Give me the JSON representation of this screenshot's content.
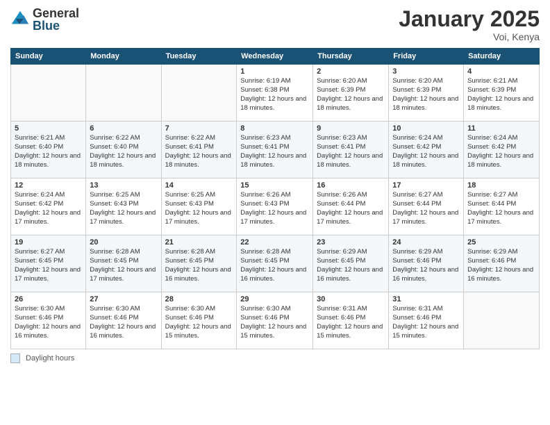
{
  "logo": {
    "general": "General",
    "blue": "Blue"
  },
  "title": "January 2025",
  "subtitle": "Voi, Kenya",
  "days_of_week": [
    "Sunday",
    "Monday",
    "Tuesday",
    "Wednesday",
    "Thursday",
    "Friday",
    "Saturday"
  ],
  "footer_label": "Daylight hours",
  "weeks": [
    [
      {
        "num": "",
        "info": ""
      },
      {
        "num": "",
        "info": ""
      },
      {
        "num": "",
        "info": ""
      },
      {
        "num": "1",
        "info": "Sunrise: 6:19 AM\nSunset: 6:38 PM\nDaylight: 12 hours and 18 minutes."
      },
      {
        "num": "2",
        "info": "Sunrise: 6:20 AM\nSunset: 6:39 PM\nDaylight: 12 hours and 18 minutes."
      },
      {
        "num": "3",
        "info": "Sunrise: 6:20 AM\nSunset: 6:39 PM\nDaylight: 12 hours and 18 minutes."
      },
      {
        "num": "4",
        "info": "Sunrise: 6:21 AM\nSunset: 6:39 PM\nDaylight: 12 hours and 18 minutes."
      }
    ],
    [
      {
        "num": "5",
        "info": "Sunrise: 6:21 AM\nSunset: 6:40 PM\nDaylight: 12 hours and 18 minutes."
      },
      {
        "num": "6",
        "info": "Sunrise: 6:22 AM\nSunset: 6:40 PM\nDaylight: 12 hours and 18 minutes."
      },
      {
        "num": "7",
        "info": "Sunrise: 6:22 AM\nSunset: 6:41 PM\nDaylight: 12 hours and 18 minutes."
      },
      {
        "num": "8",
        "info": "Sunrise: 6:23 AM\nSunset: 6:41 PM\nDaylight: 12 hours and 18 minutes."
      },
      {
        "num": "9",
        "info": "Sunrise: 6:23 AM\nSunset: 6:41 PM\nDaylight: 12 hours and 18 minutes."
      },
      {
        "num": "10",
        "info": "Sunrise: 6:24 AM\nSunset: 6:42 PM\nDaylight: 12 hours and 18 minutes."
      },
      {
        "num": "11",
        "info": "Sunrise: 6:24 AM\nSunset: 6:42 PM\nDaylight: 12 hours and 18 minutes."
      }
    ],
    [
      {
        "num": "12",
        "info": "Sunrise: 6:24 AM\nSunset: 6:42 PM\nDaylight: 12 hours and 17 minutes."
      },
      {
        "num": "13",
        "info": "Sunrise: 6:25 AM\nSunset: 6:43 PM\nDaylight: 12 hours and 17 minutes."
      },
      {
        "num": "14",
        "info": "Sunrise: 6:25 AM\nSunset: 6:43 PM\nDaylight: 12 hours and 17 minutes."
      },
      {
        "num": "15",
        "info": "Sunrise: 6:26 AM\nSunset: 6:43 PM\nDaylight: 12 hours and 17 minutes."
      },
      {
        "num": "16",
        "info": "Sunrise: 6:26 AM\nSunset: 6:44 PM\nDaylight: 12 hours and 17 minutes."
      },
      {
        "num": "17",
        "info": "Sunrise: 6:27 AM\nSunset: 6:44 PM\nDaylight: 12 hours and 17 minutes."
      },
      {
        "num": "18",
        "info": "Sunrise: 6:27 AM\nSunset: 6:44 PM\nDaylight: 12 hours and 17 minutes."
      }
    ],
    [
      {
        "num": "19",
        "info": "Sunrise: 6:27 AM\nSunset: 6:45 PM\nDaylight: 12 hours and 17 minutes."
      },
      {
        "num": "20",
        "info": "Sunrise: 6:28 AM\nSunset: 6:45 PM\nDaylight: 12 hours and 17 minutes."
      },
      {
        "num": "21",
        "info": "Sunrise: 6:28 AM\nSunset: 6:45 PM\nDaylight: 12 hours and 16 minutes."
      },
      {
        "num": "22",
        "info": "Sunrise: 6:28 AM\nSunset: 6:45 PM\nDaylight: 12 hours and 16 minutes."
      },
      {
        "num": "23",
        "info": "Sunrise: 6:29 AM\nSunset: 6:45 PM\nDaylight: 12 hours and 16 minutes."
      },
      {
        "num": "24",
        "info": "Sunrise: 6:29 AM\nSunset: 6:46 PM\nDaylight: 12 hours and 16 minutes."
      },
      {
        "num": "25",
        "info": "Sunrise: 6:29 AM\nSunset: 6:46 PM\nDaylight: 12 hours and 16 minutes."
      }
    ],
    [
      {
        "num": "26",
        "info": "Sunrise: 6:30 AM\nSunset: 6:46 PM\nDaylight: 12 hours and 16 minutes."
      },
      {
        "num": "27",
        "info": "Sunrise: 6:30 AM\nSunset: 6:46 PM\nDaylight: 12 hours and 16 minutes."
      },
      {
        "num": "28",
        "info": "Sunrise: 6:30 AM\nSunset: 6:46 PM\nDaylight: 12 hours and 15 minutes."
      },
      {
        "num": "29",
        "info": "Sunrise: 6:30 AM\nSunset: 6:46 PM\nDaylight: 12 hours and 15 minutes."
      },
      {
        "num": "30",
        "info": "Sunrise: 6:31 AM\nSunset: 6:46 PM\nDaylight: 12 hours and 15 minutes."
      },
      {
        "num": "31",
        "info": "Sunrise: 6:31 AM\nSunset: 6:46 PM\nDaylight: 12 hours and 15 minutes."
      },
      {
        "num": "",
        "info": ""
      }
    ]
  ]
}
